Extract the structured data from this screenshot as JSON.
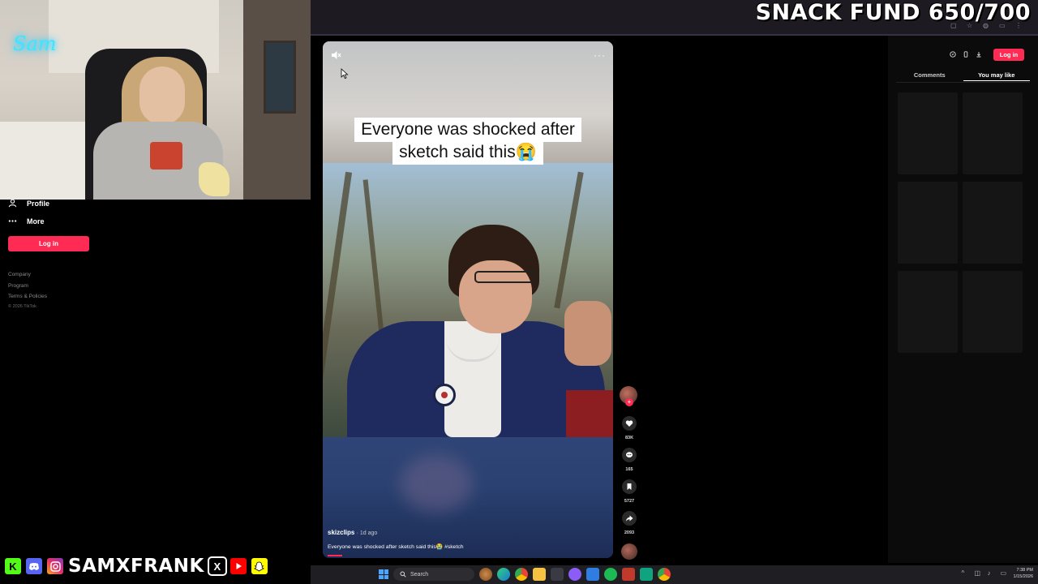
{
  "overlay": {
    "snack_fund": "SNACK FUND 650/700",
    "handle": "SAMXFRANK",
    "neon_sign": "Sam",
    "social_icons": [
      "kick-icon",
      "discord-icon",
      "instagram-icon",
      "x-icon",
      "youtube-icon",
      "snapchat-icon"
    ]
  },
  "sidebar": {
    "items": [
      {
        "label": "Profile",
        "icon": "person-icon"
      },
      {
        "label": "More",
        "icon": "ellipsis-icon"
      }
    ],
    "login_label": "Log in",
    "footer": [
      "Company",
      "Program",
      "Terms & Policies"
    ],
    "copyright": "© 2026 TikTok"
  },
  "video": {
    "caption_line1": "Everyone was shocked after",
    "caption_line2": "sketch said this😭",
    "username": "skizclips",
    "posted": "· 1d ago",
    "description": "Everyone was shocked after sketch said this😭 #sketch",
    "progress_fraction": 0.05
  },
  "actions": {
    "likes": "83K",
    "comments": "165",
    "saves": "5727",
    "shares": "2093"
  },
  "right_panel": {
    "login_label": "Log in",
    "tabs": [
      {
        "label": "Comments",
        "active": false
      },
      {
        "label": "You may like",
        "active": true
      }
    ]
  },
  "taskbar": {
    "search_label": "Search",
    "time": "7:38 PM",
    "date": "1/15/2026"
  },
  "colors": {
    "brand_pink": "#fe2c55",
    "neon": "#41e3ff",
    "background": "#000000"
  }
}
